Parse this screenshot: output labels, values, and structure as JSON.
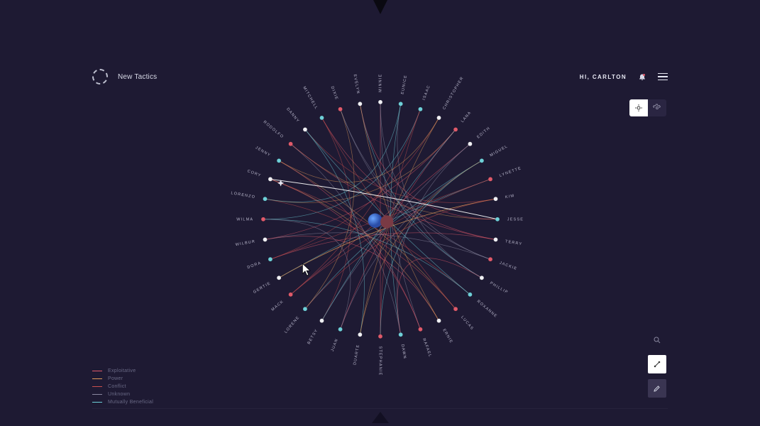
{
  "brand": {
    "title": "New Tactics"
  },
  "user": {
    "greeting": "HI, CARLTON"
  },
  "legend": {
    "items": [
      {
        "label": "Exploitative",
        "color": "#e05a6a"
      },
      {
        "label": "Power",
        "color": "#e09a5a"
      },
      {
        "label": "Conflict",
        "color": "#c94f4f"
      },
      {
        "label": "Unknown",
        "color": "#8a88a0"
      },
      {
        "label": "Mutually Beneficial",
        "color": "#6ed0d8"
      }
    ]
  },
  "nodes": [
    {
      "id": "minnie",
      "label": "MINNIE",
      "color": "#f0f0f4"
    },
    {
      "id": "eunice",
      "label": "EUNICE",
      "color": "#6ed0d8"
    },
    {
      "id": "isaac",
      "label": "ISAAC",
      "color": "#6ed0d8"
    },
    {
      "id": "christopher",
      "label": "CHRISTOPHER",
      "color": "#f0f0f4"
    },
    {
      "id": "lana",
      "label": "LANA",
      "color": "#e05a6a"
    },
    {
      "id": "edith",
      "label": "EDITH",
      "color": "#f0f0f4"
    },
    {
      "id": "miguel",
      "label": "MIGUEL",
      "color": "#6ed0d8"
    },
    {
      "id": "lynette",
      "label": "LYNETTE",
      "color": "#e05a6a"
    },
    {
      "id": "kim",
      "label": "KIM",
      "color": "#f0f0f4"
    },
    {
      "id": "jesse",
      "label": "JESSE",
      "color": "#6ed0d8"
    },
    {
      "id": "terry",
      "label": "TERRY",
      "color": "#f0f0f4"
    },
    {
      "id": "jackie",
      "label": "JACKIE",
      "color": "#e05a6a"
    },
    {
      "id": "phillip",
      "label": "PHILLIP",
      "color": "#f0f0f4"
    },
    {
      "id": "roxanne",
      "label": "ROXANNE",
      "color": "#6ed0d8"
    },
    {
      "id": "lucas",
      "label": "LUCAS",
      "color": "#e05a6a"
    },
    {
      "id": "ernie",
      "label": "ERNIE",
      "color": "#f0f0f4"
    },
    {
      "id": "rafael",
      "label": "RAFAEL",
      "color": "#e05a6a"
    },
    {
      "id": "dawn",
      "label": "DAWN",
      "color": "#6ed0d8"
    },
    {
      "id": "stephanie",
      "label": "STEPHANIE",
      "color": "#e05a6a"
    },
    {
      "id": "duarte",
      "label": "DUARTE",
      "color": "#f0f0f4"
    },
    {
      "id": "juan",
      "label": "JUAN",
      "color": "#6ed0d8"
    },
    {
      "id": "betsy",
      "label": "BETSY",
      "color": "#f0f0f4"
    },
    {
      "id": "lorene",
      "label": "LORENE",
      "color": "#6ed0d8"
    },
    {
      "id": "mack",
      "label": "MACK",
      "color": "#e05a6a"
    },
    {
      "id": "gertie",
      "label": "GERTIE",
      "color": "#f0f0f4"
    },
    {
      "id": "dora",
      "label": "DORA",
      "color": "#6ed0d8"
    },
    {
      "id": "wilbur",
      "label": "WILBUR",
      "color": "#f0f0f4"
    },
    {
      "id": "wilma",
      "label": "WILMA",
      "color": "#e05a6a"
    },
    {
      "id": "lorenzo",
      "label": "LORENZO",
      "color": "#6ed0d8"
    },
    {
      "id": "cory",
      "label": "CORY",
      "color": "#f0f0f4"
    },
    {
      "id": "jenny",
      "label": "JENNY",
      "color": "#6ed0d8"
    },
    {
      "id": "rodolfo",
      "label": "RODOLFO",
      "color": "#e05a6a"
    },
    {
      "id": "danny",
      "label": "DANNY",
      "color": "#f0f0f4"
    },
    {
      "id": "mitchell",
      "label": "MITCHELL",
      "color": "#6ed0d8"
    },
    {
      "id": "dixie",
      "label": "DIXIE",
      "color": "#e05a6a"
    },
    {
      "id": "evelyn",
      "label": "EVELYN",
      "color": "#f0f0f4"
    }
  ],
  "highlighted_edge": {
    "from": "cory",
    "to": "jesse"
  },
  "edges_color_cycle": [
    "#e05a6a",
    "#8a88a0",
    "#6ed0d8",
    "#c94f4f",
    "#e09a5a"
  ],
  "edges": [
    [
      "minnie",
      "stephanie"
    ],
    [
      "eunice",
      "phillip"
    ],
    [
      "isaac",
      "wilma"
    ],
    [
      "christopher",
      "dora"
    ],
    [
      "lana",
      "lorenzo"
    ],
    [
      "edith",
      "mack"
    ],
    [
      "miguel",
      "juan"
    ],
    [
      "lynette",
      "gertie"
    ],
    [
      "kim",
      "danny"
    ],
    [
      "jesse",
      "rodolfo"
    ],
    [
      "terry",
      "mitchell"
    ],
    [
      "jackie",
      "dixie"
    ],
    [
      "phillip",
      "evelyn"
    ],
    [
      "roxanne",
      "cory"
    ],
    [
      "lucas",
      "jenny"
    ],
    [
      "ernie",
      "wilbur"
    ],
    [
      "rafael",
      "minnie"
    ],
    [
      "dawn",
      "eunice"
    ],
    [
      "stephanie",
      "isaac"
    ],
    [
      "duarte",
      "christopher"
    ],
    [
      "juan",
      "lana"
    ],
    [
      "betsy",
      "edith"
    ],
    [
      "lorene",
      "miguel"
    ],
    [
      "mack",
      "lynette"
    ],
    [
      "gertie",
      "kim"
    ],
    [
      "dora",
      "terry"
    ],
    [
      "wilbur",
      "jackie"
    ],
    [
      "wilma",
      "roxanne"
    ],
    [
      "lorenzo",
      "lucas"
    ],
    [
      "cory",
      "ernie"
    ],
    [
      "jenny",
      "rafael"
    ],
    [
      "rodolfo",
      "dawn"
    ],
    [
      "danny",
      "duarte"
    ],
    [
      "mitchell",
      "betsy"
    ],
    [
      "dixie",
      "lorene"
    ],
    [
      "evelyn",
      "jesse"
    ],
    [
      "minnie",
      "jackie"
    ],
    [
      "eunice",
      "lorenzo"
    ],
    [
      "isaac",
      "mack"
    ],
    [
      "christopher",
      "jenny"
    ],
    [
      "lana",
      "wilbur"
    ],
    [
      "edith",
      "dawn"
    ],
    [
      "miguel",
      "stephanie"
    ],
    [
      "lynette",
      "dora"
    ],
    [
      "kim",
      "gertie"
    ],
    [
      "terry",
      "rodolfo"
    ],
    [
      "phillip",
      "dixie"
    ],
    [
      "roxanne",
      "danny"
    ],
    [
      "lucas",
      "mitchell"
    ],
    [
      "ernie",
      "evelyn"
    ],
    [
      "rafael",
      "cory"
    ],
    [
      "juan",
      "wilma"
    ],
    [
      "betsy",
      "lana"
    ],
    [
      "lorene",
      "kim"
    ],
    [
      "duarte",
      "miguel"
    ],
    [
      "dawn",
      "phillip"
    ]
  ]
}
